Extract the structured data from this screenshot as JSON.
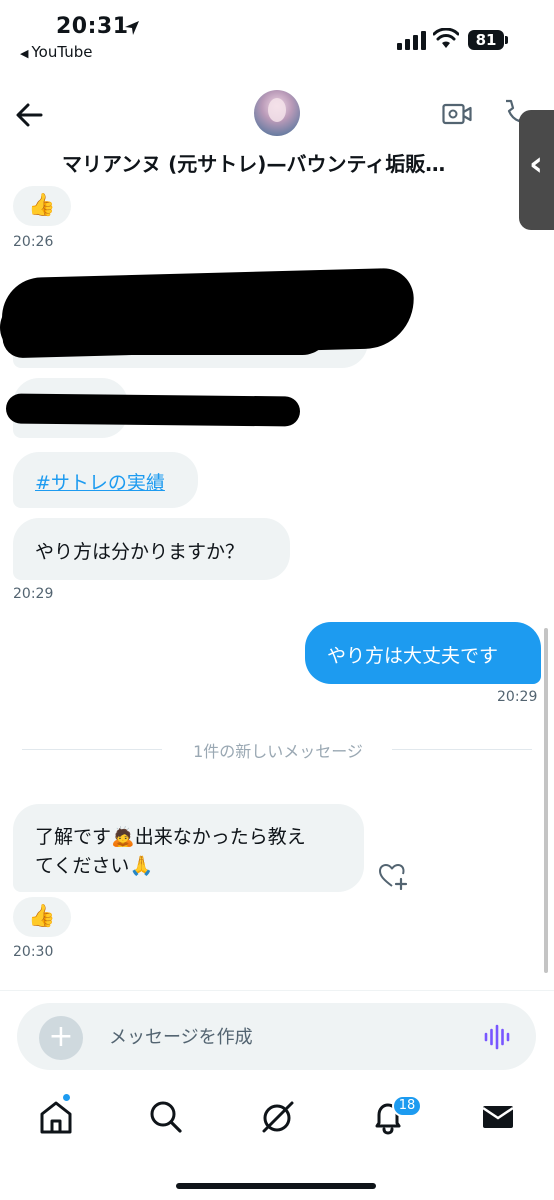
{
  "status_bar": {
    "time": "20:31",
    "back_app": "YouTube",
    "battery": "81"
  },
  "header": {
    "title": "マリアンヌ (元サトレ)—バウンティ垢販…"
  },
  "messages": {
    "reaction_1_emoji": "👍",
    "reaction_1_time": "20:26",
    "hashtag": "#サトレの実績",
    "question": "やり方は分かりますか？",
    "question_time": "20:29",
    "reply": "やり方は大丈夫です",
    "reply_time": "20:29",
    "new_divider": "1件の新しいメッセージ",
    "last_line_1_a": "了解です",
    "last_line_1_emoji": "🙇",
    "last_line_1_b": "出来なかったら教え",
    "last_line_2": "てください",
    "last_line_2_emoji": "🙏",
    "reaction_2_emoji": "👍",
    "reaction_2_time": "20:30"
  },
  "composer": {
    "placeholder": "メッセージを作成"
  },
  "nav": {
    "notifications_count": "18"
  },
  "colors": {
    "accent": "#1d9bf0",
    "bubble_in": "#eff3f4",
    "text": "#0f1419",
    "muted": "#536471"
  }
}
